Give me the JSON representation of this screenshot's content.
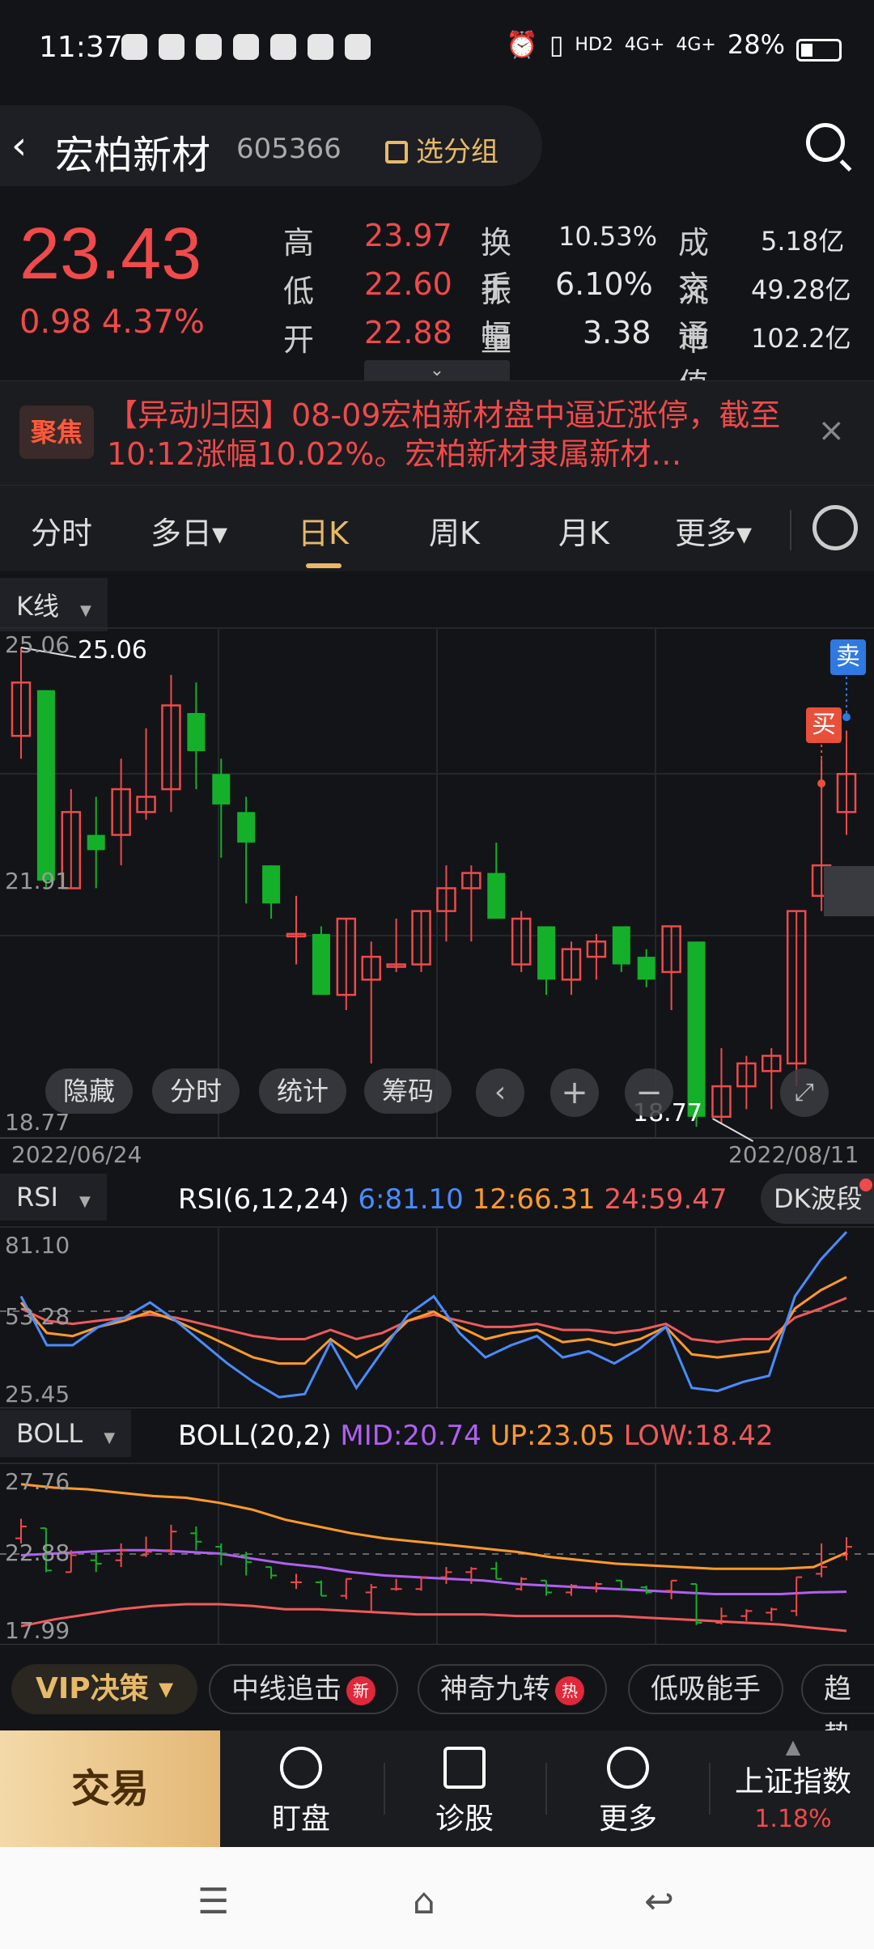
{
  "status": {
    "time": "11:37",
    "network1": "HD2",
    "network2": "4G+",
    "network3": "4G+",
    "battery": "28%"
  },
  "header": {
    "back": "‹",
    "name": "宏柏新材",
    "code": "605366",
    "group_btn": "选分组"
  },
  "quote": {
    "price": "23.43",
    "change": "0.98",
    "change_pct": "4.37%",
    "rows": [
      {
        "l1": "高",
        "v1": "23.97",
        "l2": "换手",
        "v2": "10.53%",
        "l3": "成交",
        "v3": "5.18亿"
      },
      {
        "l1": "低",
        "v1": "22.60",
        "l2": "振幅",
        "v2": "6.10%",
        "l3": "流通",
        "v3": "49.28亿"
      },
      {
        "l1": "开",
        "v1": "22.88",
        "l2": "量比",
        "v2": "3.38",
        "l3": "市值",
        "v3": "102.2亿"
      }
    ],
    "expand": "⌄"
  },
  "news": {
    "badge": "聚焦",
    "text": "【异动归因】08-09宏柏新材盘中逼近涨停，截至10:12涨幅10.02%。宏柏新材隶属新材…",
    "close": "×"
  },
  "tabs": [
    {
      "label": "分时"
    },
    {
      "label": "多日▾"
    },
    {
      "label": "日K"
    },
    {
      "label": "周K"
    },
    {
      "label": "月K"
    },
    {
      "label": "更多▾"
    }
  ],
  "kchart": {
    "selector": "K线",
    "max_label": "25.06",
    "mid_label": "21.91",
    "min_label": "18.77",
    "high_annot": "25.06",
    "low_annot": "18.77",
    "date_start": "2022/06/24",
    "date_end": "2022/08/11",
    "sell": "卖",
    "buy": "买",
    "buttons": [
      "隐藏",
      "分时",
      "统计",
      "筹码"
    ],
    "colors": {
      "up": "#f04a4a",
      "down": "#14b02a"
    }
  },
  "rsi": {
    "selector": "RSI",
    "title": "RSI(6,12,24)",
    "r6": "6:81.10",
    "r12": "12:66.31",
    "r24": "24:59.47",
    "axis_top": "81.10",
    "axis_mid": "53.28",
    "axis_bot": "25.45",
    "dk": "DK波段",
    "colors": {
      "r6": "#4a8cff",
      "r12": "#ff9a2a",
      "r24": "#f05a5a"
    }
  },
  "boll": {
    "selector": "BOLL",
    "title": "BOLL(20,2)",
    "mid": "MID:20.74",
    "up": "UP:23.05",
    "low": "LOW:18.42",
    "axis_top": "27.76",
    "axis_mid": "22.88",
    "axis_bot": "17.99",
    "colors": {
      "mid": "#b060f0",
      "up": "#ff9a2a",
      "low": "#f05a5a"
    }
  },
  "tools": {
    "vip": "VIP决策 ▾",
    "chips": [
      {
        "label": "中线追击",
        "tag": "新"
      },
      {
        "label": "神奇九转",
        "tag": "热"
      },
      {
        "label": "低吸能手",
        "tag": ""
      },
      {
        "label": "趋势",
        "tag": ""
      }
    ]
  },
  "bottomnav": {
    "trade": "交易",
    "items": [
      "盯盘",
      "诊股",
      "更多"
    ],
    "index_name": "上证指数",
    "index_pct": "1.18%"
  },
  "chart_data": {
    "type": "candlestick",
    "title": "",
    "ylim": [
      18.77,
      25.06
    ],
    "x_range": [
      "2022/06/24",
      "2022/08/11"
    ],
    "candles": [
      {
        "o": 23.9,
        "c": 24.6,
        "h": 25.06,
        "l": 23.6
      },
      {
        "o": 24.5,
        "c": 22.0,
        "h": 24.5,
        "l": 21.9
      },
      {
        "o": 21.9,
        "c": 22.9,
        "h": 23.2,
        "l": 21.9
      },
      {
        "o": 22.6,
        "c": 22.4,
        "h": 23.1,
        "l": 21.9
      },
      {
        "o": 22.6,
        "c": 23.2,
        "h": 23.6,
        "l": 22.2
      },
      {
        "o": 22.9,
        "c": 23.1,
        "h": 24.0,
        "l": 22.8
      },
      {
        "o": 23.2,
        "c": 24.3,
        "h": 24.7,
        "l": 22.9
      },
      {
        "o": 24.2,
        "c": 23.7,
        "h": 24.6,
        "l": 23.2
      },
      {
        "o": 23.4,
        "c": 23.0,
        "h": 23.6,
        "l": 22.3
      },
      {
        "o": 22.9,
        "c": 22.5,
        "h": 23.1,
        "l": 21.7
      },
      {
        "o": 22.2,
        "c": 21.7,
        "h": 22.2,
        "l": 21.5
      },
      {
        "o": 21.3,
        "c": 21.3,
        "h": 21.8,
        "l": 20.9
      },
      {
        "o": 21.3,
        "c": 20.5,
        "h": 21.4,
        "l": 20.5
      },
      {
        "o": 20.5,
        "c": 21.5,
        "h": 21.5,
        "l": 20.3
      },
      {
        "o": 20.7,
        "c": 21.0,
        "h": 21.2,
        "l": 19.6
      },
      {
        "o": 20.9,
        "c": 20.9,
        "h": 21.5,
        "l": 20.8
      },
      {
        "o": 20.9,
        "c": 21.6,
        "h": 21.6,
        "l": 20.8
      },
      {
        "o": 21.6,
        "c": 21.9,
        "h": 22.2,
        "l": 21.2
      },
      {
        "o": 21.9,
        "c": 22.1,
        "h": 22.2,
        "l": 21.2
      },
      {
        "o": 22.1,
        "c": 21.5,
        "h": 22.5,
        "l": 21.5
      },
      {
        "o": 20.9,
        "c": 21.5,
        "h": 21.6,
        "l": 20.8
      },
      {
        "o": 21.4,
        "c": 20.7,
        "h": 21.4,
        "l": 20.5
      },
      {
        "o": 20.7,
        "c": 21.1,
        "h": 21.2,
        "l": 20.5
      },
      {
        "o": 21.0,
        "c": 21.2,
        "h": 21.3,
        "l": 20.7
      },
      {
        "o": 21.4,
        "c": 20.9,
        "h": 21.4,
        "l": 20.8
      },
      {
        "o": 21.0,
        "c": 20.7,
        "h": 21.1,
        "l": 20.6
      },
      {
        "o": 20.8,
        "c": 21.4,
        "h": 21.4,
        "l": 20.3
      },
      {
        "o": 21.2,
        "c": 18.9,
        "h": 21.2,
        "l": 18.77
      },
      {
        "o": 18.9,
        "c": 19.3,
        "h": 19.8,
        "l": 18.8
      },
      {
        "o": 19.3,
        "c": 19.6,
        "h": 19.7,
        "l": 19.0
      },
      {
        "o": 19.5,
        "c": 19.7,
        "h": 19.8,
        "l": 19.0
      },
      {
        "o": 19.6,
        "c": 21.6,
        "h": 21.6,
        "l": 19.3
      },
      {
        "o": 21.8,
        "c": 22.2,
        "h": 23.6,
        "l": 21.6
      },
      {
        "o": 22.9,
        "c": 23.4,
        "h": 23.97,
        "l": 22.6
      }
    ],
    "rsi": {
      "ylim": [
        25.45,
        81.1
      ],
      "r6": [
        60,
        44,
        44,
        50,
        53,
        58,
        52,
        45,
        38,
        32,
        27,
        28,
        45,
        30,
        42,
        54,
        60,
        48,
        40,
        44,
        47,
        40,
        42,
        38,
        43,
        50,
        30,
        29,
        32,
        34,
        60,
        72,
        81.1
      ],
      "r12": [
        58,
        48,
        47,
        50,
        52,
        55,
        52,
        48,
        44,
        40,
        38,
        38,
        46,
        40,
        44,
        52,
        55,
        50,
        46,
        48,
        49,
        45,
        46,
        44,
        46,
        50,
        41,
        40,
        41,
        42,
        56,
        62,
        66.31
      ],
      "r24": [
        56,
        52,
        51,
        52,
        53,
        54,
        53,
        51,
        49,
        47,
        46,
        46,
        49,
        46,
        48,
        52,
        54,
        52,
        50,
        50,
        51,
        49,
        49,
        48,
        49,
        51,
        46,
        45,
        46,
        46,
        53,
        56,
        59.47
      ]
    },
    "boll": {
      "ylim": [
        17.99,
        27.76
      ],
      "up": [
        27.1,
        26.9,
        26.8,
        26.6,
        26.4,
        26.3,
        26.0,
        25.6,
        25.0,
        24.6,
        24.2,
        23.9,
        23.7,
        23.5,
        23.3,
        23.1,
        22.8,
        22.6,
        22.4,
        22.3,
        22.2,
        22.1,
        22.1,
        22.1,
        22.2,
        23.05
      ],
      "mid": [
        22.9,
        23.0,
        23.1,
        23.2,
        23.2,
        23.1,
        23.0,
        22.7,
        22.4,
        22.2,
        21.9,
        21.7,
        21.6,
        21.5,
        21.4,
        21.2,
        21.1,
        21.0,
        20.9,
        20.8,
        20.7,
        20.6,
        20.6,
        20.6,
        20.7,
        20.74
      ],
      "low": [
        18.7,
        19.1,
        19.4,
        19.7,
        19.9,
        20.0,
        20.0,
        19.9,
        19.7,
        19.7,
        19.6,
        19.5,
        19.4,
        19.4,
        19.4,
        19.3,
        19.3,
        19.3,
        19.3,
        19.2,
        19.1,
        19.0,
        18.9,
        18.8,
        18.6,
        18.42
      ]
    }
  }
}
